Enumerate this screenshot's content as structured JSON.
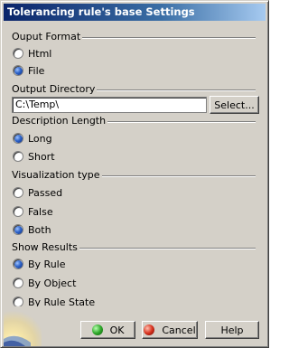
{
  "window": {
    "title": "Tolerancing rule's base Settings"
  },
  "output_format": {
    "label": "Ouput Format",
    "options": [
      {
        "label": "Html",
        "selected": false
      },
      {
        "label": "File",
        "selected": true
      }
    ]
  },
  "output_directory": {
    "label": "Output Directory",
    "value": "C:\\Temp\\",
    "select_label": "Select..."
  },
  "description_length": {
    "label": "Description Length",
    "options": [
      {
        "label": "Long",
        "selected": true
      },
      {
        "label": "Short",
        "selected": false
      }
    ]
  },
  "visualization_type": {
    "label": "Visualization type",
    "options": [
      {
        "label": "Passed",
        "selected": false
      },
      {
        "label": "False",
        "selected": false
      },
      {
        "label": "Both",
        "selected": true
      }
    ]
  },
  "show_results": {
    "label": "Show Results",
    "options": [
      {
        "label": "By Rule",
        "selected": true
      },
      {
        "label": "By Object",
        "selected": false
      },
      {
        "label": "By Rule State",
        "selected": false
      }
    ]
  },
  "buttons": {
    "ok": "OK",
    "cancel": "Cancel",
    "help": "Help"
  },
  "colors": {
    "title_start": "#0a246a",
    "title_end": "#a6caf0",
    "face": "#d4d0c8"
  }
}
